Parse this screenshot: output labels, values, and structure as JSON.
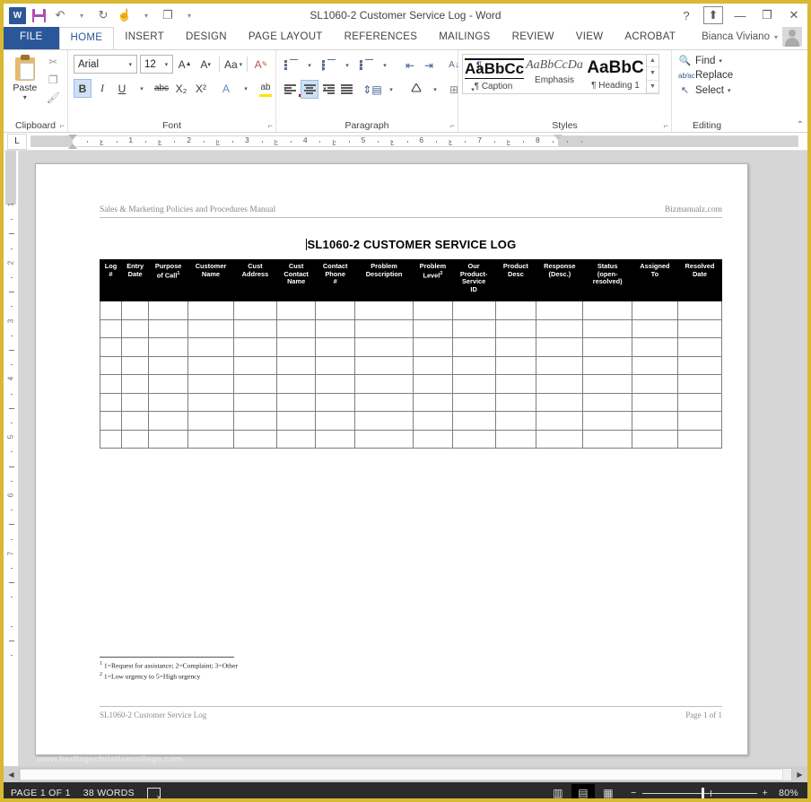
{
  "window": {
    "title": "SL1060-2 Customer Service Log - Word",
    "quick_access": [
      {
        "name": "word-logo-icon",
        "label": "W"
      },
      {
        "name": "save-icon",
        "label": ""
      },
      {
        "name": "undo-icon",
        "label": "↶"
      },
      {
        "name": "undo-caret-icon",
        "label": "▾"
      },
      {
        "name": "redo-icon",
        "label": "↻"
      },
      {
        "name": "touch-mode-icon",
        "label": "☝"
      },
      {
        "name": "touch-caret-icon",
        "label": "▾"
      },
      {
        "name": "new-comment-icon",
        "label": "❐"
      },
      {
        "name": "customize-qat-icon",
        "label": "▾"
      }
    ],
    "controls": {
      "help": "?",
      "ribbon_display": "⬆",
      "minimize": "—",
      "restore": "❐",
      "close": "✕"
    },
    "account_name": "Bianca Viviano",
    "account_caret": "▾"
  },
  "tabs": [
    {
      "label": "FILE",
      "state": "file"
    },
    {
      "label": "HOME",
      "state": "active"
    },
    {
      "label": "INSERT",
      "state": "normal"
    },
    {
      "label": "DESIGN",
      "state": "normal"
    },
    {
      "label": "PAGE LAYOUT",
      "state": "normal"
    },
    {
      "label": "REFERENCES",
      "state": "normal"
    },
    {
      "label": "MAILINGS",
      "state": "normal"
    },
    {
      "label": "REVIEW",
      "state": "normal"
    },
    {
      "label": "VIEW",
      "state": "normal"
    },
    {
      "label": "ACROBAT",
      "state": "normal"
    }
  ],
  "ribbon": {
    "clipboard": {
      "group_label": "Clipboard",
      "paste_label": "Paste",
      "paste_caret": "▾",
      "cut_icon": "✂",
      "copy_icon": "❐",
      "format_painter_icon": "🖌"
    },
    "font": {
      "group_label": "Font",
      "font_name": "Arial",
      "font_size": "12",
      "grow_font": "A",
      "shrink_font": "A",
      "change_case": "Aa",
      "clear_formatting": "A",
      "bold": "B",
      "italic": "I",
      "underline": "U",
      "strikethrough": "abc",
      "subscript": "X₂",
      "superscript": "X²",
      "text_effects": "A",
      "highlight": "ab",
      "font_color": "A"
    },
    "paragraph": {
      "group_label": "Paragraph",
      "bullets": "bullets-icon",
      "numbering": "numbering-icon",
      "multilevel": "multilevel-list-icon",
      "decrease_indent": "⇤",
      "increase_indent": "⇥",
      "sort": "A↓",
      "show_marks": "¶",
      "align_left": "align-left-icon",
      "align_center": "align-center-icon",
      "align_right": "align-right-icon",
      "justify": "justify-icon",
      "line_spacing": "line-spacing-icon",
      "shading": "shading-icon",
      "borders": "borders-icon"
    },
    "styles": {
      "group_label": "Styles",
      "items": [
        {
          "preview": "AaBbCc",
          "name": "¶ Caption"
        },
        {
          "preview": "AaBbCcDa",
          "name": "Emphasis"
        },
        {
          "preview": "AaBbC",
          "name": "¶ Heading 1"
        }
      ],
      "scroll_up": "▲",
      "scroll_down": "▼",
      "more": "▼"
    },
    "editing": {
      "group_label": "Editing",
      "find": "Find",
      "find_caret": "▾",
      "replace": "Replace",
      "select": "Select",
      "select_caret": "▾"
    },
    "collapse_icon": "⌃"
  },
  "ruler": {
    "tab_stop_label": "L",
    "numbers": [
      "1",
      "2",
      "3",
      "4",
      "5",
      "6",
      "7",
      "8"
    ],
    "left_tab_marker": "L",
    "vertical_numbers": [
      "1",
      "2",
      "3",
      "4",
      "5",
      "6",
      "7"
    ]
  },
  "document": {
    "header_left": "Sales & Marketing Policies and Procedures Manual",
    "header_right": "Bizmanualz.com",
    "title": "SL1060-2 CUSTOMER SERVICE LOG",
    "table": {
      "columns": [
        {
          "line1": "Log",
          "line2": "#",
          "line3": "",
          "line4": "",
          "sup": ""
        },
        {
          "line1": "Entry",
          "line2": "Date",
          "line3": "",
          "line4": "",
          "sup": ""
        },
        {
          "line1": "Purpose",
          "line2": "of Call",
          "line3": "",
          "line4": "",
          "sup": "1"
        },
        {
          "line1": "Customer",
          "line2": "Name",
          "line3": "",
          "line4": "",
          "sup": ""
        },
        {
          "line1": "Cust",
          "line2": "Address",
          "line3": "",
          "line4": "",
          "sup": ""
        },
        {
          "line1": "Cust",
          "line2": "Contact",
          "line3": "Name",
          "line4": "",
          "sup": ""
        },
        {
          "line1": "Contact",
          "line2": "Phone",
          "line3": "#",
          "line4": "",
          "sup": ""
        },
        {
          "line1": "Problem",
          "line2": "Description",
          "line3": "",
          "line4": "",
          "sup": ""
        },
        {
          "line1": "Problem",
          "line2": "Level",
          "line3": "",
          "line4": "",
          "sup": "2"
        },
        {
          "line1": "Our",
          "line2": "Product-",
          "line3": "Service",
          "line4": "ID",
          "sup": ""
        },
        {
          "line1": "Product",
          "line2": "Desc",
          "line3": "",
          "line4": "",
          "sup": ""
        },
        {
          "line1": "Response",
          "line2": "(Desc.)",
          "line3": "",
          "line4": "",
          "sup": ""
        },
        {
          "line1": "Status",
          "line2": "(open-",
          "line3": "resolved)",
          "line4": "",
          "sup": ""
        },
        {
          "line1": "Assigned",
          "line2": "To",
          "line3": "",
          "line4": "",
          "sup": ""
        },
        {
          "line1": "Resolved",
          "line2": "Date",
          "line3": "",
          "line4": "",
          "sup": ""
        }
      ],
      "empty_row_count": 8
    },
    "footnotes": [
      {
        "marker": "1",
        "text": "1=Request for assistance; 2=Complaint; 3=Other"
      },
      {
        "marker": "2",
        "text": "1=Low urgency to 5=High urgency"
      }
    ],
    "footer_left": "SL1060-2 Customer Service Log",
    "footer_right": "Page 1 of 1"
  },
  "watermark": "www.heritagechristiancollege.com",
  "scrollbars": {
    "left_arrow": "◀",
    "right_arrow": "▶"
  },
  "statusbar": {
    "page_info": "PAGE 1 OF 1",
    "word_count": "38 WORDS",
    "proofing_icon": "proofing-errors-icon",
    "views": [
      {
        "name": "read-mode-view",
        "glyph": "▥",
        "active": false
      },
      {
        "name": "print-layout-view",
        "glyph": "▤",
        "active": true
      },
      {
        "name": "web-layout-view",
        "glyph": "▦",
        "active": false
      }
    ],
    "zoom_out": "−",
    "zoom_in": "+",
    "zoom_level": "80%"
  },
  "colors": {
    "accent": "#2b579a",
    "window_border": "#d8b932",
    "statusbar_bg": "#2b2b2b",
    "table_header_bg": "#000000"
  }
}
